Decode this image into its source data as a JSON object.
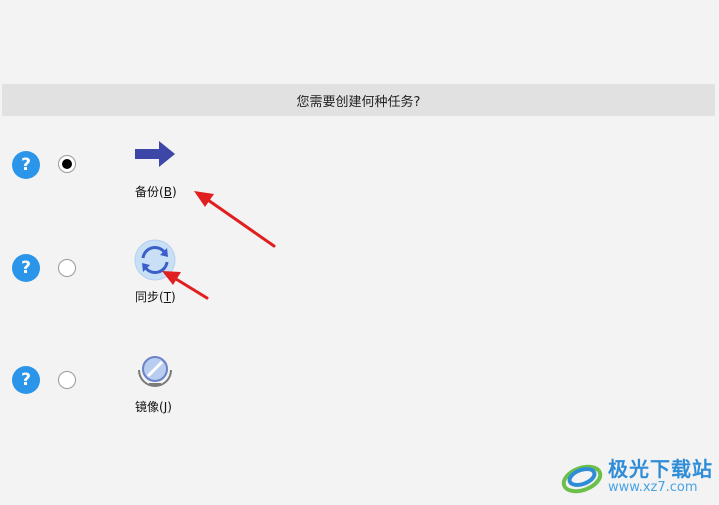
{
  "prompt": {
    "title": "您需要创建何种任务?"
  },
  "options": [
    {
      "label": "备份",
      "shortcut": "B",
      "selected": true,
      "icon": "arrow-right-icon"
    },
    {
      "label": "同步",
      "shortcut": "T",
      "selected": false,
      "icon": "sync-icon"
    },
    {
      "label": "镜像",
      "shortcut": "J",
      "selected": false,
      "icon": "mirror-icon"
    }
  ],
  "watermark": {
    "title": "极光下载站",
    "url": "www.xz7.com"
  },
  "colors": {
    "accent_blue": "#2b95e9",
    "annotation_red": "#e02020",
    "header_bg": "#e1e1e1"
  }
}
